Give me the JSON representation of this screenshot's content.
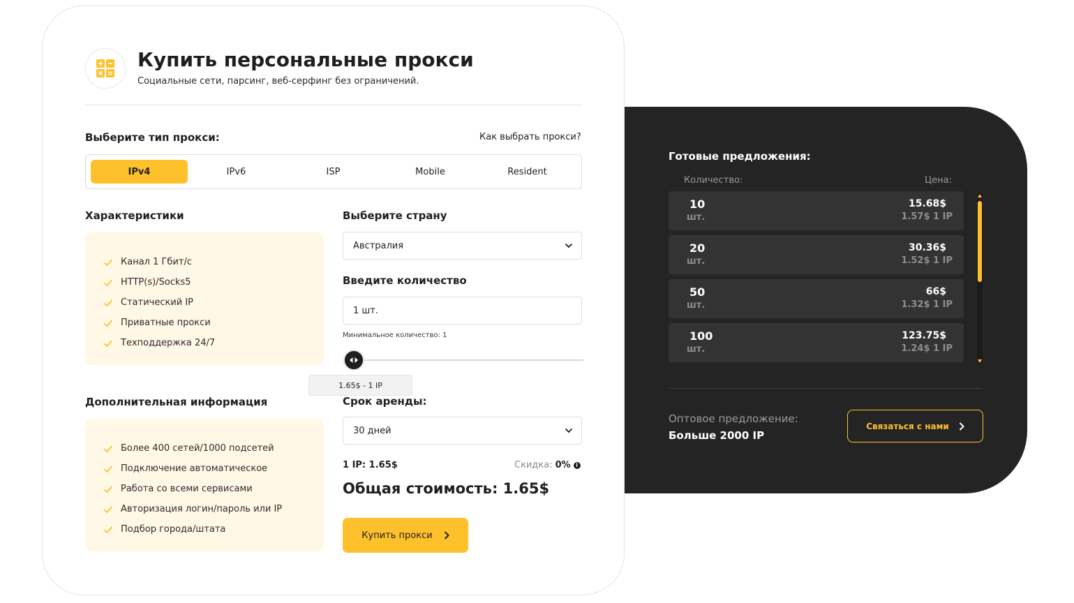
{
  "header": {
    "title": "Купить персональные прокси",
    "subtitle": "Социальные сети, парсинг, веб-серфинг без ограничений.",
    "logo_icon": "calculator-icon"
  },
  "proxy_type": {
    "label": "Выберите тип прокси:",
    "help_link": "Как выбрать прокси?",
    "tabs": [
      {
        "label": "IPv4",
        "active": true
      },
      {
        "label": "IPv6",
        "active": false
      },
      {
        "label": "ISP",
        "active": false
      },
      {
        "label": "Mobile",
        "active": false
      },
      {
        "label": "Resident",
        "active": false
      }
    ]
  },
  "characteristics": {
    "title": "Характеристики",
    "items": [
      "Канал 1 Гбит/с",
      "HTTP(s)/Socks5",
      "Статический IP",
      "Приватные прокси",
      "Техподдержка 24/7"
    ]
  },
  "additional": {
    "title": "Дополнительная информация",
    "items": [
      "Более 400 сетей/1000 подсетей",
      "Подключение автоматическое",
      "Работа со всеми сервисами",
      "Авторизация логин/пароль или IP",
      "Подбор города/штата"
    ]
  },
  "country": {
    "label": "Выберите страну",
    "selected": "Австралия"
  },
  "quantity": {
    "label": "Введите количество",
    "value": "1 шт.",
    "min_note": "Минимальное количество: 1",
    "slider_value": 1,
    "tooltip": "1.65$ - 1 IP"
  },
  "rent": {
    "label": "Срок аренды:",
    "selected": "30 дней"
  },
  "summary": {
    "per_ip": "1 IP: 1.65$",
    "discount_label": "Скидка:",
    "discount_value": "0%",
    "total": "Общая стоимость: 1.65$",
    "buy_label": "Купить прокси"
  },
  "offers": {
    "title": "Готовые предложения:",
    "qty_header": "Количество:",
    "price_header": "Цена:",
    "items": [
      {
        "qty": "10",
        "unit": "шт.",
        "price": "15.68$",
        "per": "1.57$ 1 IP"
      },
      {
        "qty": "20",
        "unit": "шт.",
        "price": "30.36$",
        "per": "1.52$ 1 IP"
      },
      {
        "qty": "50",
        "unit": "шт.",
        "price": "66$",
        "per": "1.32$ 1 IP"
      },
      {
        "qty": "100",
        "unit": "шт.",
        "price": "123.75$",
        "per": "1.24$ 1 IP"
      }
    ],
    "wholesale_label": "Оптовое предложение:",
    "wholesale_value": "Больше 2000 IP",
    "contact_label": "Связаться с нами"
  },
  "colors": {
    "accent": "#ffc12b",
    "dark_panel": "#242424",
    "offer_card": "#333333",
    "feature_bg": "#fff8e6"
  }
}
